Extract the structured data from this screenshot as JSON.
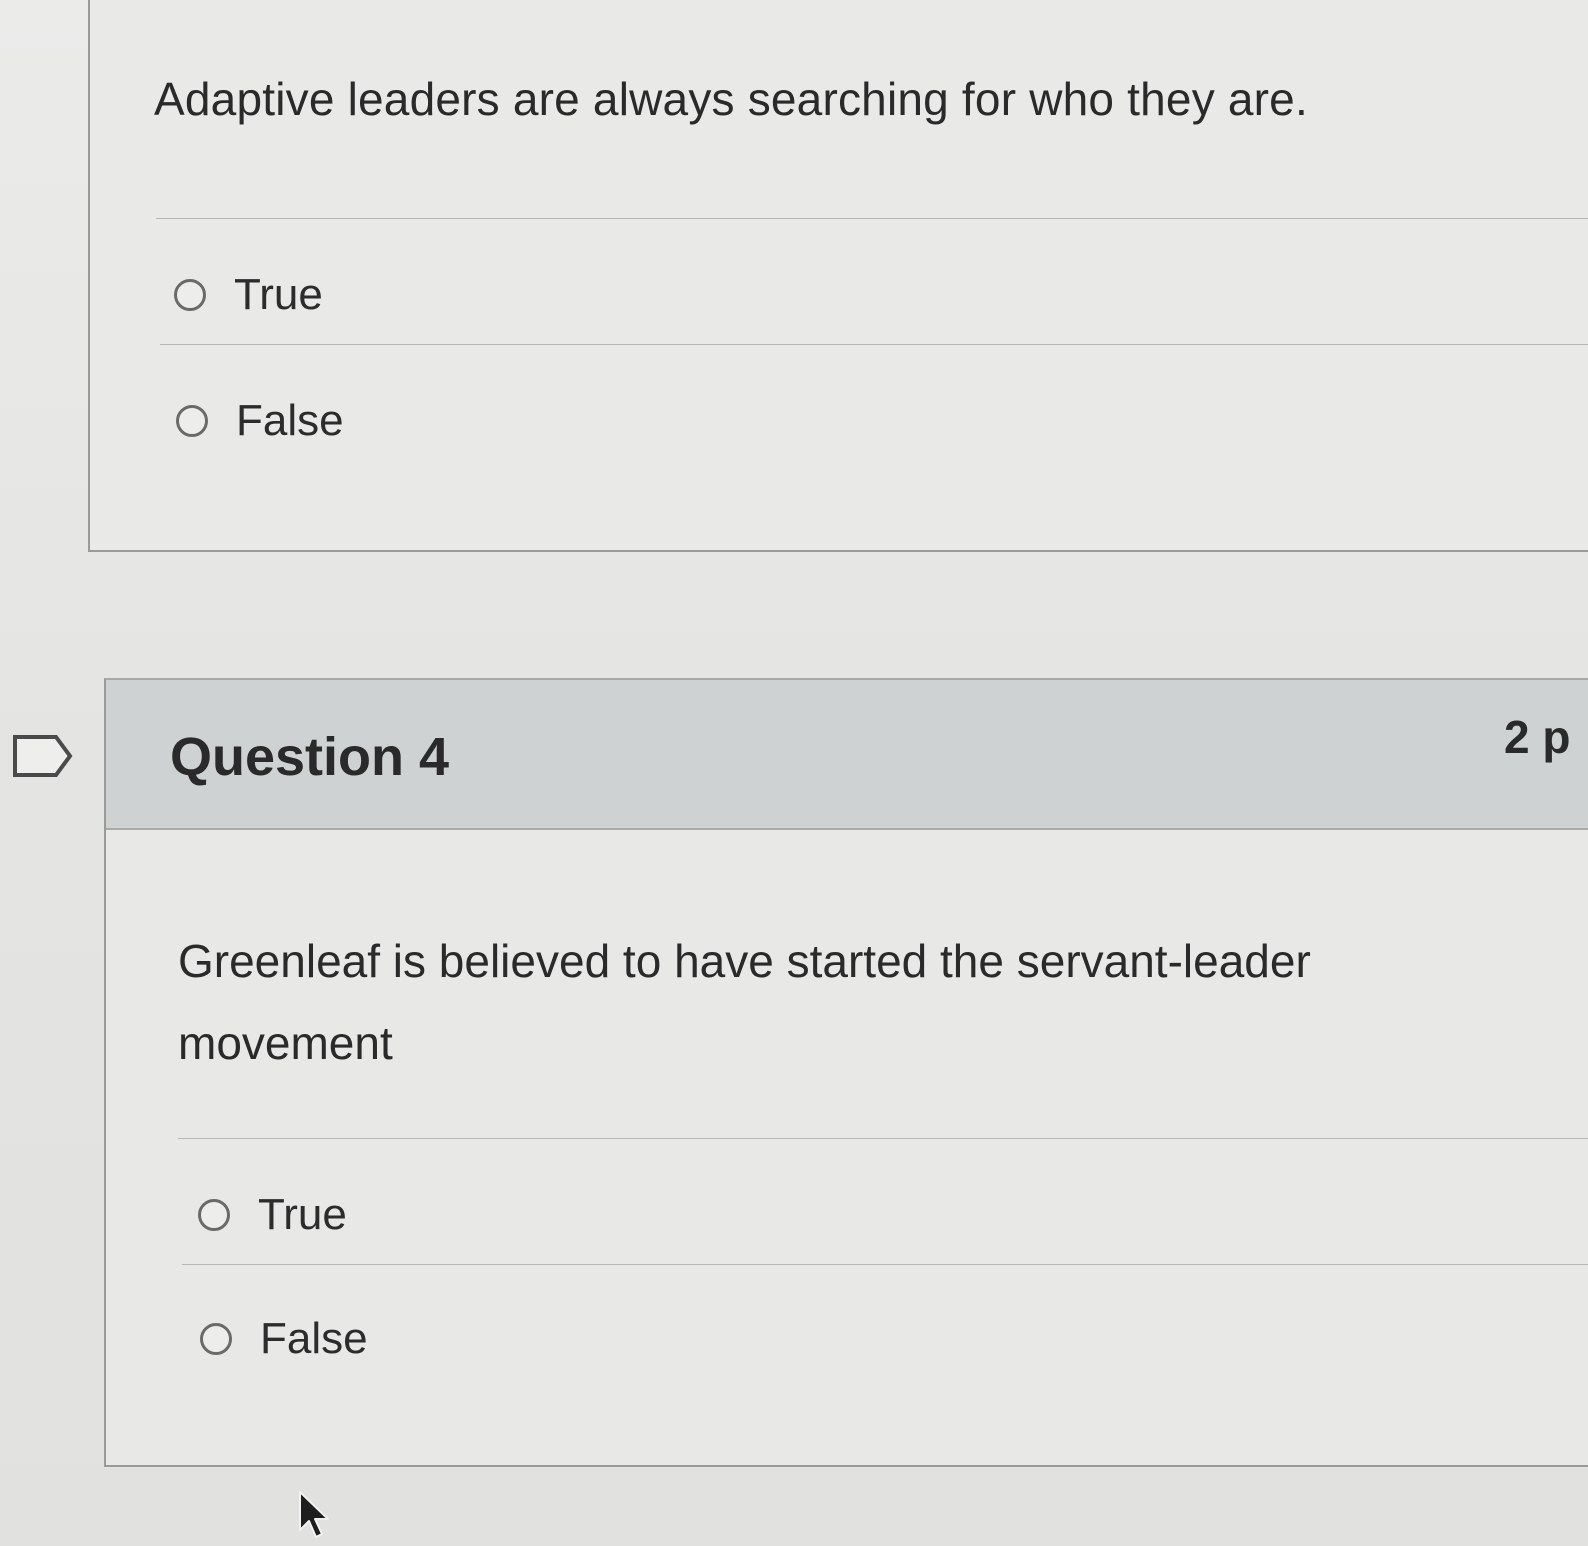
{
  "question3": {
    "prompt": "Adaptive leaders are always searching for who they are.",
    "answers": [
      {
        "label": "True"
      },
      {
        "label": "False"
      }
    ]
  },
  "question4": {
    "title": "Question 4",
    "points": "2 p",
    "prompt": "Greenleaf is believed to have started the servant-leader movement",
    "answers": [
      {
        "label": "True"
      },
      {
        "label": "False"
      }
    ]
  },
  "icons": {
    "flag": "flag-icon",
    "cursor": "mouse-cursor-icon",
    "radio": "radio-button"
  },
  "colors": {
    "header_background": "#cfd2d3",
    "page_background": "#e6e6e4",
    "text": "#2a2a2a"
  }
}
